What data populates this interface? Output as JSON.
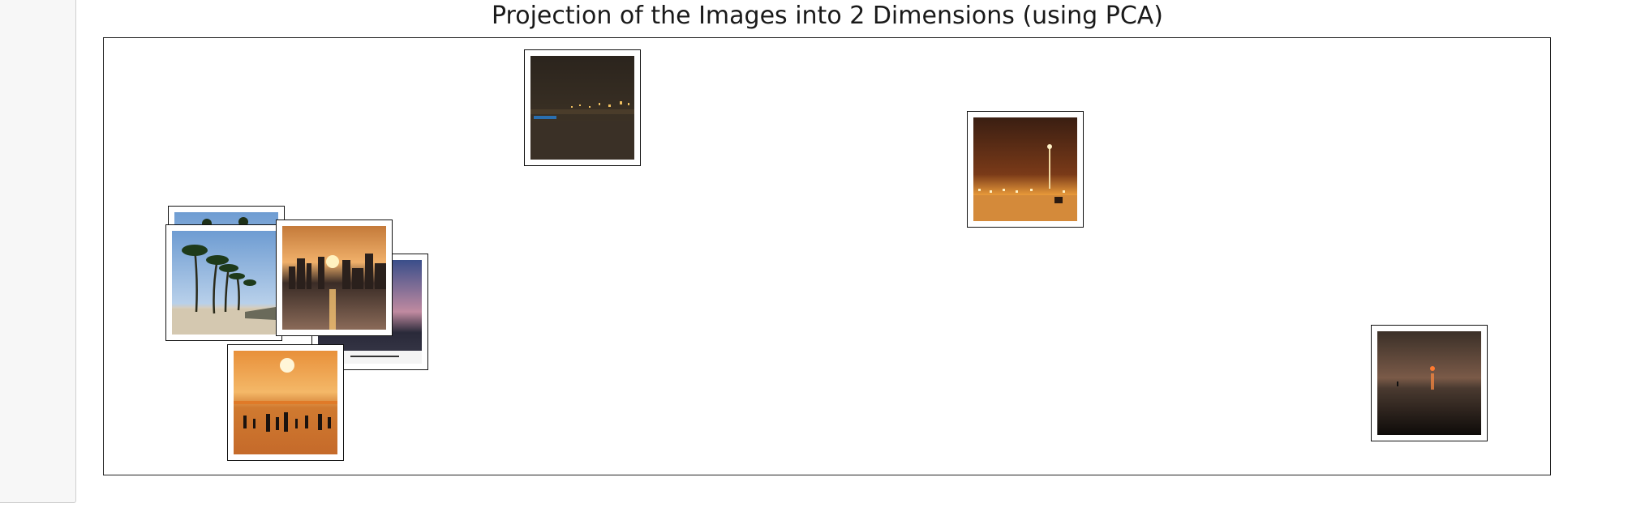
{
  "page": {
    "background": "#ffffff",
    "gutter_color": "#f7f7f7"
  },
  "chart_data": {
    "type": "scatter",
    "title": "Projection of the Images into 2 Dimensions (using PCA)",
    "xlabel": "",
    "ylabel": "",
    "axes_visible": false,
    "ticks": "none",
    "marker": "image thumbnails",
    "points": [
      {
        "id": "beach-palms-partial",
        "scene": "beach with palm trees (partially hidden)",
        "x": 1.35,
        "y": 6.1
      },
      {
        "id": "beach-palms",
        "scene": "beach with palm trees, blue sky",
        "x": 1.3,
        "y": 4.55
      },
      {
        "id": "sunset-sea-partial",
        "scene": "sunset over sea (partially hidden)",
        "x": 2.8,
        "y": 3.2
      },
      {
        "id": "city-sunset",
        "scene": "city skyline sunset over water",
        "x": 2.2,
        "y": 4.5
      },
      {
        "id": "sunset-people",
        "scene": "sunset beach with silhouettes of people",
        "x": 1.75,
        "y": 1.45
      },
      {
        "id": "night-beach-city",
        "scene": "night beach with city lights",
        "x": 3.35,
        "y": 8.6
      },
      {
        "id": "night-beach-lamp",
        "scene": "night beach with street lamp",
        "x": 6.3,
        "y": 7.25
      },
      {
        "id": "dusk-sea",
        "scene": "dusk over the sea",
        "x": 9.0,
        "y": 2.0
      }
    ],
    "colors": {
      "night_sky": "#2a241c",
      "sunset_orange": "#f0a040",
      "sky_blue": "#7aa8d8",
      "sand": "#d8cdb8"
    }
  }
}
